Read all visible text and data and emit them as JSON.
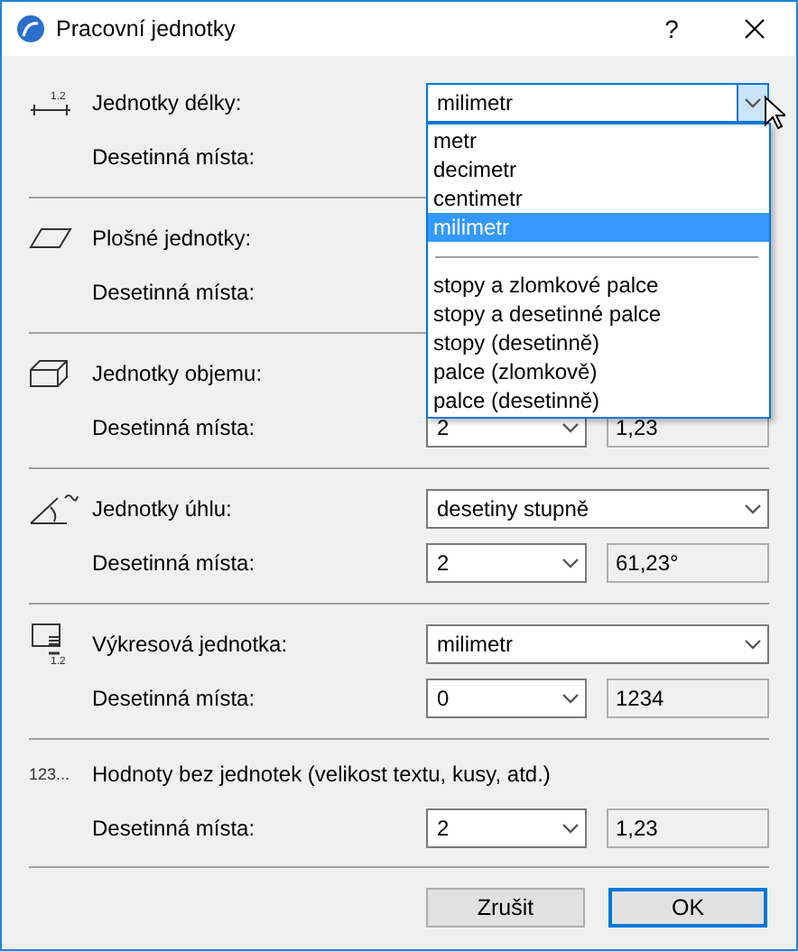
{
  "window": {
    "title": "Pracovní jednotky",
    "help": "?"
  },
  "sections": [
    {
      "kind": "length",
      "caption": "1.2",
      "label": "Jednotky délky:",
      "unit_select": {
        "value": "milimetr",
        "focused": true,
        "options": [
          {
            "kind": "option",
            "label": "metr",
            "selected": false
          },
          {
            "kind": "option",
            "label": "decimetr",
            "selected": false
          },
          {
            "kind": "option",
            "label": "centimetr",
            "selected": false
          },
          {
            "kind": "option",
            "label": "milimetr",
            "selected": true
          },
          {
            "kind": "separator"
          },
          {
            "kind": "option",
            "label": "stopy a zlomkové palce",
            "selected": false
          },
          {
            "kind": "option",
            "label": "stopy a desetinné palce",
            "selected": false
          },
          {
            "kind": "option",
            "label": "stopy (desetinně)",
            "selected": false
          },
          {
            "kind": "option",
            "label": "palce (zlomkově)",
            "selected": false
          },
          {
            "kind": "option",
            "label": "palce (desetinně)",
            "selected": false
          }
        ]
      },
      "decimals": {
        "label": "Desetinná místa:"
      }
    },
    {
      "kind": "area",
      "label": "Plošné jednotky:",
      "decimals": {
        "label": "Desetinná místa:"
      }
    },
    {
      "kind": "volume",
      "label": "Jednotky objemu:",
      "decimals": {
        "label": "Desetinná místa:",
        "value": "2",
        "preview": "1,23"
      }
    },
    {
      "kind": "angle",
      "label": "Jednotky úhlu:",
      "unit_select": {
        "value": "desetiny stupně",
        "focused": false
      },
      "decimals": {
        "label": "Desetinná místa:",
        "value": "2",
        "preview": "61,23°"
      }
    },
    {
      "kind": "drawing",
      "caption": "1.2",
      "label": "Výkresová jednotka:",
      "unit_select": {
        "value": "milimetr",
        "focused": false
      },
      "decimals": {
        "label": "Desetinná místa:",
        "value": "0",
        "preview": "1234"
      }
    },
    {
      "icon_text": "123...",
      "label": "Hodnoty bez jednotek (velikost textu, kusy, atd.)",
      "decimals": {
        "label": "Desetinná místa:",
        "value": "2",
        "preview": "1,23"
      }
    }
  ],
  "buttons": [
    {
      "label": "Zrušit",
      "default": false
    },
    {
      "label": "OK",
      "default": true
    }
  ]
}
